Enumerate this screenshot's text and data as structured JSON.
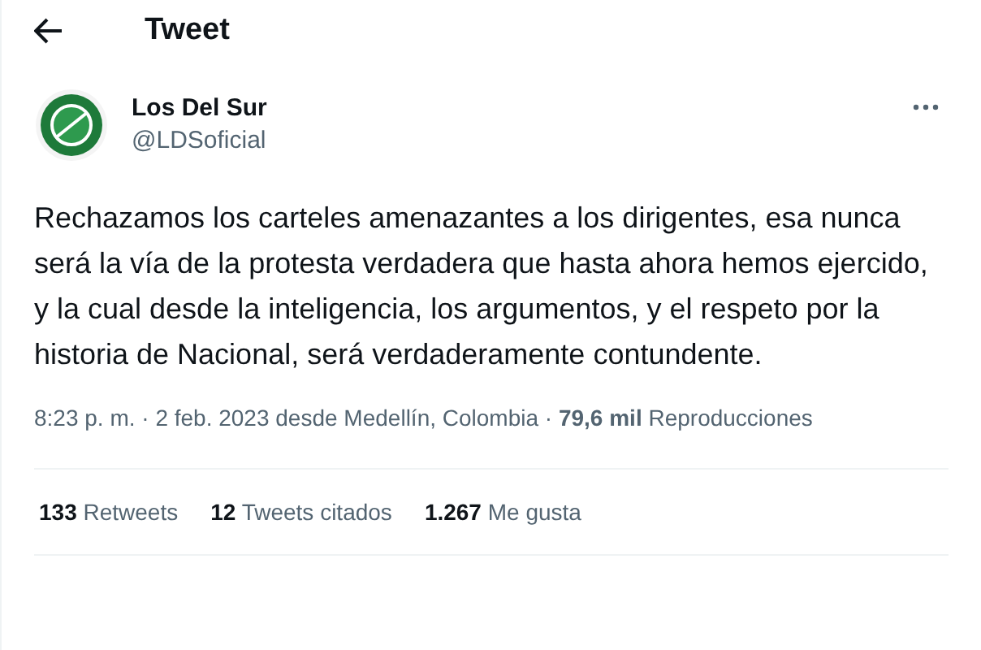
{
  "header": {
    "title": "Tweet"
  },
  "author": {
    "name": "Los Del Sur",
    "handle": "@LDSoficial"
  },
  "text": "Rechazamos los carteles amenazantes a los dirigentes, esa nunca será la vía de la protesta verdadera que hasta ahora hemos ejercido, y la cual desde la inteligencia, los argumentos, y el respeto por la historia de Nacional, será verdaderamente contundente.",
  "meta": "8:23 p. m. · 2 feb. 2023 desde Medellín, Colombia · **79,6 mil** Reproducciones",
  "stats": [
    {
      "count": "133",
      "label": "Retweets"
    },
    {
      "count": "12",
      "label": "Tweets citados"
    },
    {
      "count": "1.267",
      "label": "Me gusta"
    }
  ]
}
